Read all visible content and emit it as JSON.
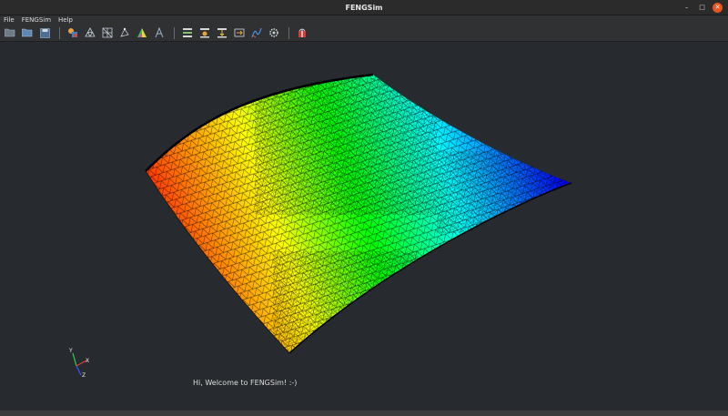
{
  "window": {
    "title": "FENGSim"
  },
  "menu": [
    {
      "name": "menu-file",
      "label": "File"
    },
    {
      "name": "menu-fengsim",
      "label": "FENGSim"
    },
    {
      "name": "menu-help",
      "label": "Help"
    }
  ],
  "toolbar": {
    "groups": [
      [
        "open-file-icon",
        "open-folder-icon",
        "save-icon"
      ],
      [
        "geometry-shapes-icon",
        "mesh-icon",
        "grid-mesh-icon",
        "vertex-icon",
        "prism-color-icon",
        "measure-icon"
      ],
      [
        "layer-stack-icon",
        "slice-icon",
        "extrude-icon",
        "transfer-icon",
        "curve-icon",
        "gear-icon"
      ],
      [
        "gift-icon"
      ]
    ]
  },
  "viewport": {
    "message": "Hi, Welcome to FENGSim! :-)",
    "colormap": [
      "#ff0000",
      "#ffff00",
      "#00ff00",
      "#00ffff",
      "#0000ff"
    ],
    "axes": {
      "x": "X",
      "y": "Y",
      "z": "Z"
    }
  }
}
